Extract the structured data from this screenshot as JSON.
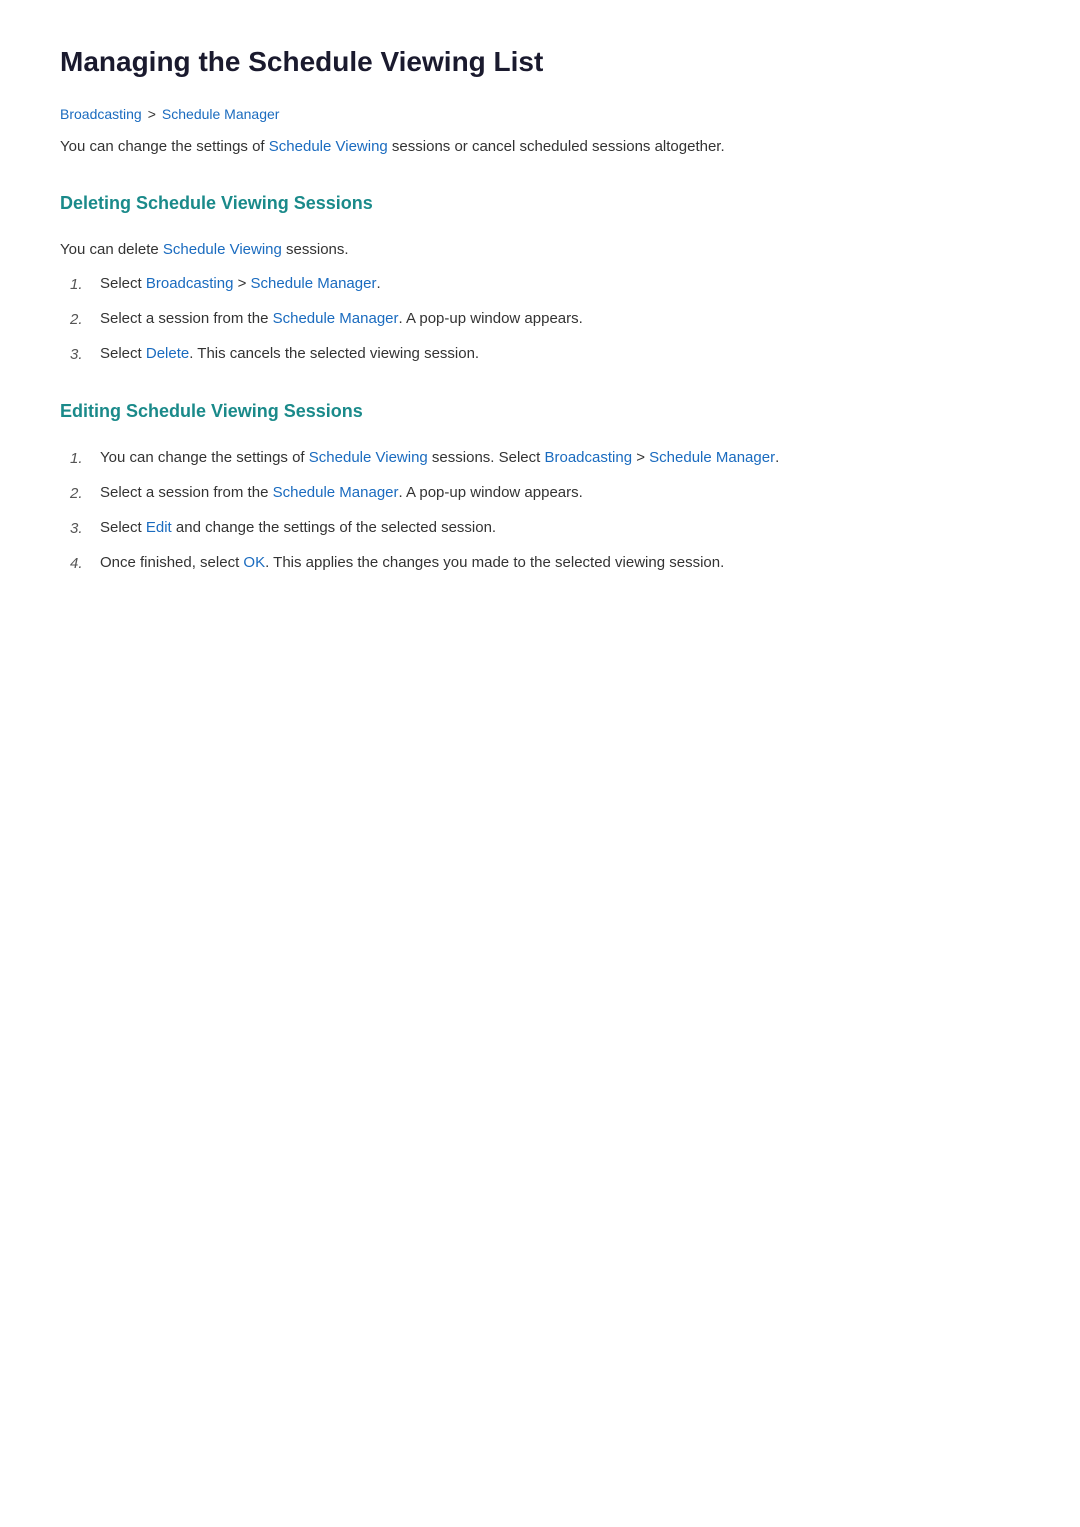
{
  "page": {
    "title": "Managing the Schedule Viewing List",
    "breadcrumb": {
      "item1": "Broadcasting",
      "separator": ">",
      "item2": "Schedule Manager"
    },
    "intro": "You can change the settings of Schedule Viewing sessions or cancel scheduled sessions altogether.",
    "section1": {
      "title": "Deleting Schedule Viewing Sessions",
      "intro": "You can delete Schedule Viewing sessions.",
      "steps": [
        {
          "number": "1.",
          "text_before": "Select ",
          "highlight1": "Broadcasting",
          "separator": " > ",
          "highlight2": "Schedule Manager",
          "text_after": "."
        },
        {
          "number": "2.",
          "text_before": "Select a session from the ",
          "highlight1": "Schedule Manager",
          "text_after": ". A pop-up window appears."
        },
        {
          "number": "3.",
          "text_before": "Select ",
          "highlight1": "Delete",
          "text_after": ". This cancels the selected viewing session."
        }
      ]
    },
    "section2": {
      "title": "Editing Schedule Viewing Sessions",
      "steps": [
        {
          "number": "1.",
          "text_before": "You can change the settings of ",
          "highlight1": "Schedule Viewing",
          "text_middle": " sessions. Select ",
          "highlight2": "Broadcasting",
          "separator": " > ",
          "highlight3": "Schedule Manager",
          "text_after": "."
        },
        {
          "number": "2.",
          "text_before": "Select a session from the ",
          "highlight1": "Schedule Manager",
          "text_after": ". A pop-up window appears."
        },
        {
          "number": "3.",
          "text_before": "Select ",
          "highlight1": "Edit",
          "text_after": " and change the settings of the selected session."
        },
        {
          "number": "4.",
          "text_before": "Once finished, select ",
          "highlight1": "OK",
          "text_after": ". This applies the changes you made to the selected viewing session."
        }
      ]
    }
  }
}
